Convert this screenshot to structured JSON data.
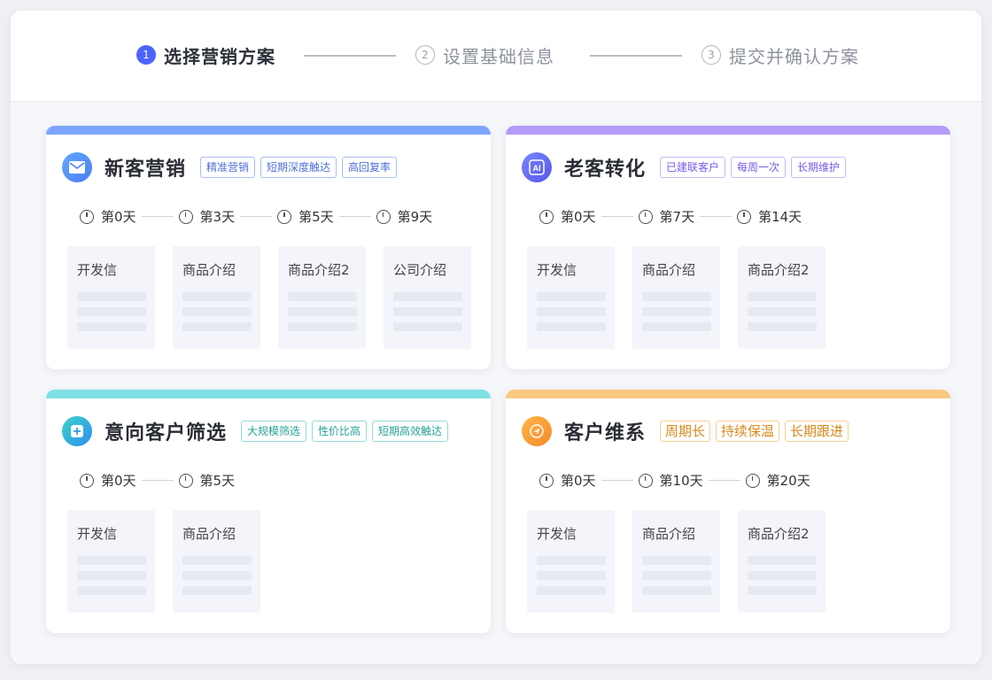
{
  "steps": [
    {
      "num": "1",
      "label": "选择营销方案",
      "active": true
    },
    {
      "num": "2",
      "label": "设置基础信息",
      "active": false
    },
    {
      "num": "3",
      "label": "提交并确认方案",
      "active": false
    }
  ],
  "cards": [
    {
      "title": "新客营销",
      "icon": "mail-icon",
      "color": "#7ea6ff",
      "tags": [
        "精准营销",
        "短期深度触达",
        "高回复率"
      ],
      "timeline": [
        "第0天",
        "第3天",
        "第5天",
        "第9天"
      ],
      "tiles": [
        "开发信",
        "商品介绍",
        "商品介绍2",
        "公司介绍"
      ]
    },
    {
      "title": "老客转化",
      "icon": "ai-icon",
      "color": "#b39bfa",
      "tags": [
        "已建联客户",
        "每周一次",
        "长期维护"
      ],
      "timeline": [
        "第0天",
        "第7天",
        "第14天"
      ],
      "tiles": [
        "开发信",
        "商品介绍",
        "商品介绍2"
      ]
    },
    {
      "title": "意向客户筛选",
      "icon": "filter-plus-icon",
      "color": "#7ee0e3",
      "tags": [
        "大规模筛选",
        "性价比高",
        "短期高效触达"
      ],
      "timeline": [
        "第0天",
        "第5天"
      ],
      "tiles": [
        "开发信",
        "商品介绍"
      ]
    },
    {
      "title": "客户维系",
      "icon": "send-icon",
      "color": "#f8c983",
      "tags": [
        "周期长",
        "持续保温",
        "长期跟进"
      ],
      "timeline": [
        "第0天",
        "第10天",
        "第20天"
      ],
      "tiles": [
        "开发信",
        "商品介绍",
        "商品介绍2"
      ]
    }
  ]
}
